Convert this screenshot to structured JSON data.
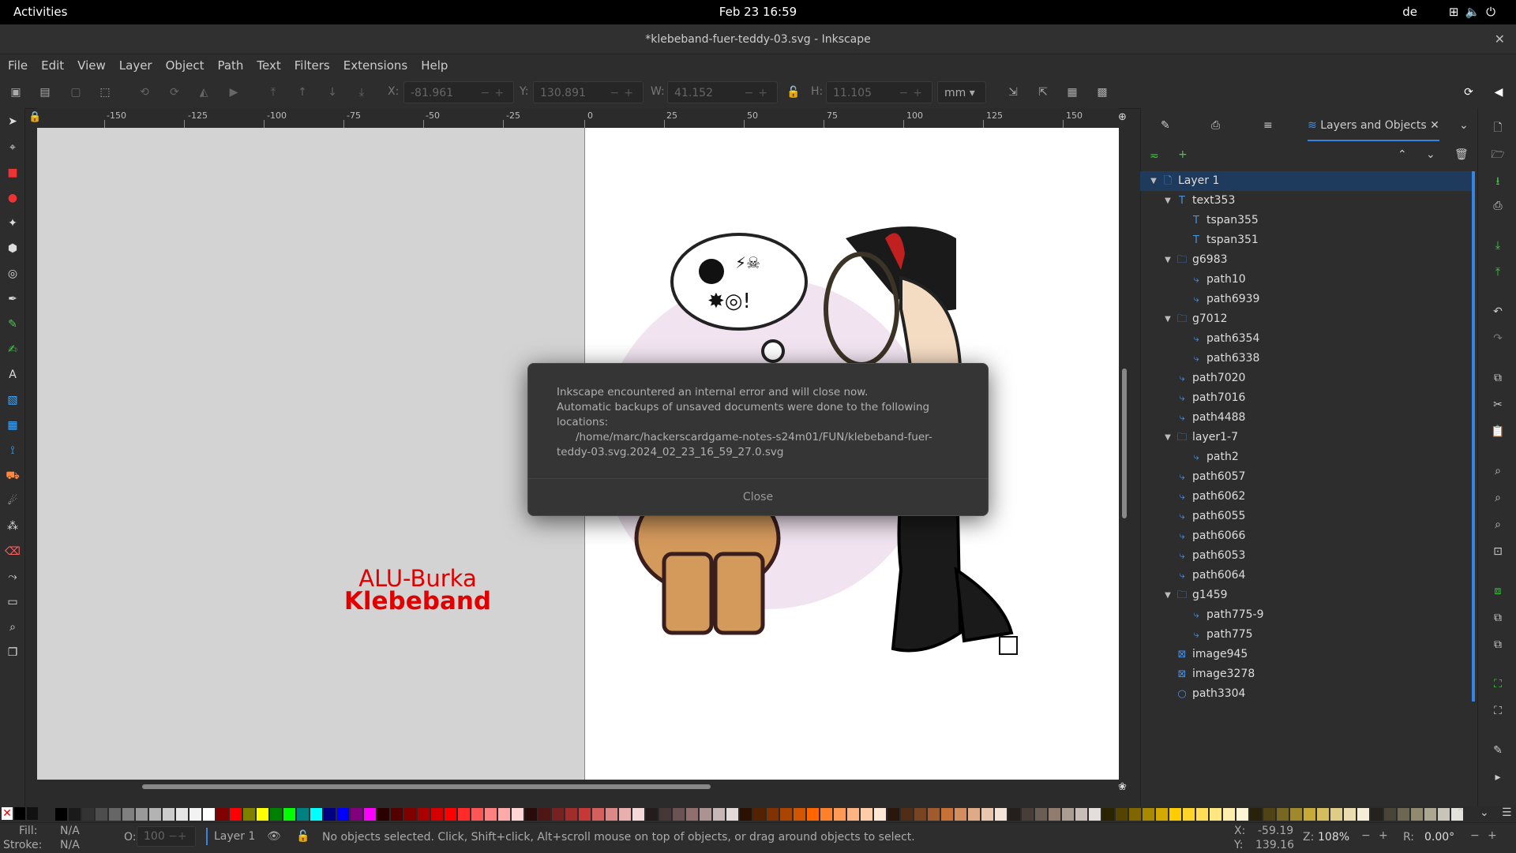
{
  "topbar": {
    "activities": "Activities",
    "clock": "Feb 23  16:59",
    "lang": "de"
  },
  "window": {
    "title": "*klebeband-fuer-teddy-03.svg - Inkscape",
    "close": "✕"
  },
  "menu": [
    "File",
    "Edit",
    "View",
    "Layer",
    "Object",
    "Path",
    "Text",
    "Filters",
    "Extensions",
    "Help"
  ],
  "coords": {
    "x_label": "X:",
    "x_value": "-81.961",
    "y_label": "Y:",
    "y_value": "130.891",
    "w_label": "W:",
    "w_value": "41.152",
    "h_label": "H:",
    "h_value": "11.105",
    "unit": "mm"
  },
  "ruler_ticks": [
    "-150",
    "-125",
    "-100",
    "-75",
    "-50",
    "-25",
    "0",
    "25",
    "50",
    "75",
    "100",
    "125",
    "150"
  ],
  "canvas_text": {
    "line1": "ALU-Burka",
    "line2": "Klebeband"
  },
  "dialog": {
    "line1": "Inkscape encountered an internal error and will close now.",
    "line2": "Automatic backups of unsaved documents were done to the following locations:",
    "line3": "/home/marc/hackerscardgame-notes-s24m01/FUN/klebeband-fuer-",
    "line4": "teddy-03.svg.2024_02_23_16_59_27.0.svg",
    "close": "Close"
  },
  "panel": {
    "active_tab": "Layers and Objects"
  },
  "tree": [
    {
      "label": "Layer 1",
      "level": 0,
      "icon": "layer",
      "expand": "down",
      "selected": true
    },
    {
      "label": "text353",
      "level": 1,
      "icon": "text",
      "expand": "down"
    },
    {
      "label": "tspan355",
      "level": 2,
      "icon": "tspan",
      "expand": ""
    },
    {
      "label": "tspan351",
      "level": 2,
      "icon": "tspan",
      "expand": ""
    },
    {
      "label": "g6983",
      "level": 1,
      "icon": "group",
      "expand": "down"
    },
    {
      "label": "path10",
      "level": 2,
      "icon": "path",
      "expand": ""
    },
    {
      "label": "path6939",
      "level": 2,
      "icon": "path",
      "expand": ""
    },
    {
      "label": "g7012",
      "level": 1,
      "icon": "group",
      "expand": "down"
    },
    {
      "label": "path6354",
      "level": 2,
      "icon": "path",
      "expand": ""
    },
    {
      "label": "path6338",
      "level": 2,
      "icon": "path",
      "expand": ""
    },
    {
      "label": "path7020",
      "level": 1,
      "icon": "path",
      "expand": ""
    },
    {
      "label": "path7016",
      "level": 1,
      "icon": "path",
      "expand": ""
    },
    {
      "label": "path4488",
      "level": 1,
      "icon": "path",
      "expand": ""
    },
    {
      "label": "layer1-7",
      "level": 1,
      "icon": "group",
      "expand": "down"
    },
    {
      "label": "path2",
      "level": 2,
      "icon": "path",
      "expand": ""
    },
    {
      "label": "path6057",
      "level": 1,
      "icon": "path",
      "expand": ""
    },
    {
      "label": "path6062",
      "level": 1,
      "icon": "path",
      "expand": ""
    },
    {
      "label": "path6055",
      "level": 1,
      "icon": "path",
      "expand": ""
    },
    {
      "label": "path6066",
      "level": 1,
      "icon": "path",
      "expand": ""
    },
    {
      "label": "path6053",
      "level": 1,
      "icon": "path",
      "expand": ""
    },
    {
      "label": "path6064",
      "level": 1,
      "icon": "path",
      "expand": ""
    },
    {
      "label": "g1459",
      "level": 1,
      "icon": "group",
      "expand": "down"
    },
    {
      "label": "path775-9",
      "level": 2,
      "icon": "path",
      "expand": ""
    },
    {
      "label": "path775",
      "level": 2,
      "icon": "path",
      "expand": ""
    },
    {
      "label": "image945",
      "level": 1,
      "icon": "image",
      "expand": ""
    },
    {
      "label": "image3278",
      "level": 1,
      "icon": "image",
      "expand": ""
    },
    {
      "label": "path3304",
      "level": 1,
      "icon": "circle",
      "expand": ""
    }
  ],
  "palette": [
    "#000000",
    "#1a1a1a",
    "#333333",
    "#4d4d4d",
    "#666666",
    "#808080",
    "#999999",
    "#b3b3b3",
    "#cccccc",
    "#e6e6e6",
    "#f2f2f2",
    "#ffffff",
    "#800000",
    "#ff0000",
    "#808000",
    "#ffff00",
    "#008000",
    "#00ff00",
    "#008080",
    "#00ffff",
    "#000080",
    "#0000ff",
    "#800080",
    "#ff00ff",
    "#2b0000",
    "#550000",
    "#800000",
    "#aa0000",
    "#d40000",
    "#ff0000",
    "#ff2a2a",
    "#ff5555",
    "#ff8080",
    "#ffaaaa",
    "#ffd5d5",
    "#280b0b",
    "#501616",
    "#782121",
    "#a02c2c",
    "#c83737",
    "#d35f5f",
    "#de8787",
    "#e9afaf",
    "#f4d7d7",
    "#241c1c",
    "#483737",
    "#6c5353",
    "#916f6f",
    "#ac9393",
    "#c8b7b7",
    "#e3dbdb",
    "#2b1100",
    "#552200",
    "#803300",
    "#aa4400",
    "#d45500",
    "#ff6600",
    "#ff7f2a",
    "#ff9955",
    "#ffb380",
    "#ffccaa",
    "#ffe6d5",
    "#28170b",
    "#502d16",
    "#784421",
    "#a05a2c",
    "#c87137",
    "#d38d5f",
    "#deaa87",
    "#e9c6af",
    "#f4e3d7",
    "#241f1c",
    "#483e37",
    "#6c5d53",
    "#917c6f",
    "#ac9d93",
    "#c8beb7",
    "#e3dedb",
    "#2b2200",
    "#554400",
    "#806600",
    "#aa8800",
    "#d4aa00",
    "#ffcc00",
    "#ffd42a",
    "#ffdd55",
    "#ffe680",
    "#ffeeaa",
    "#fff6d5",
    "#28220b",
    "#504416",
    "#786721",
    "#a0892c",
    "#c8ab37",
    "#d4bd5f",
    "#decd87",
    "#e9ddaf",
    "#f4eed7",
    "#24221c",
    "#484537",
    "#6c6753",
    "#918a6f",
    "#aca793",
    "#c8c4b7",
    "#e3e2db"
  ],
  "status": {
    "fill_label": "Fill:",
    "fill_value": "N/A",
    "stroke_label": "Stroke:",
    "stroke_value": "N/A",
    "opacity_label": "O:",
    "opacity_value": "100",
    "layer": "Layer 1",
    "message": "No objects selected. Click, Shift+click, Alt+scroll mouse on top of objects, or drag around objects to select.",
    "x_label": "X:",
    "x_value": "-59.19",
    "y_label": "Y:",
    "y_value": "139.16",
    "zoom_label": "Z:",
    "zoom_value": "108%",
    "rot_label": "R:",
    "rot_value": "0.00°"
  }
}
